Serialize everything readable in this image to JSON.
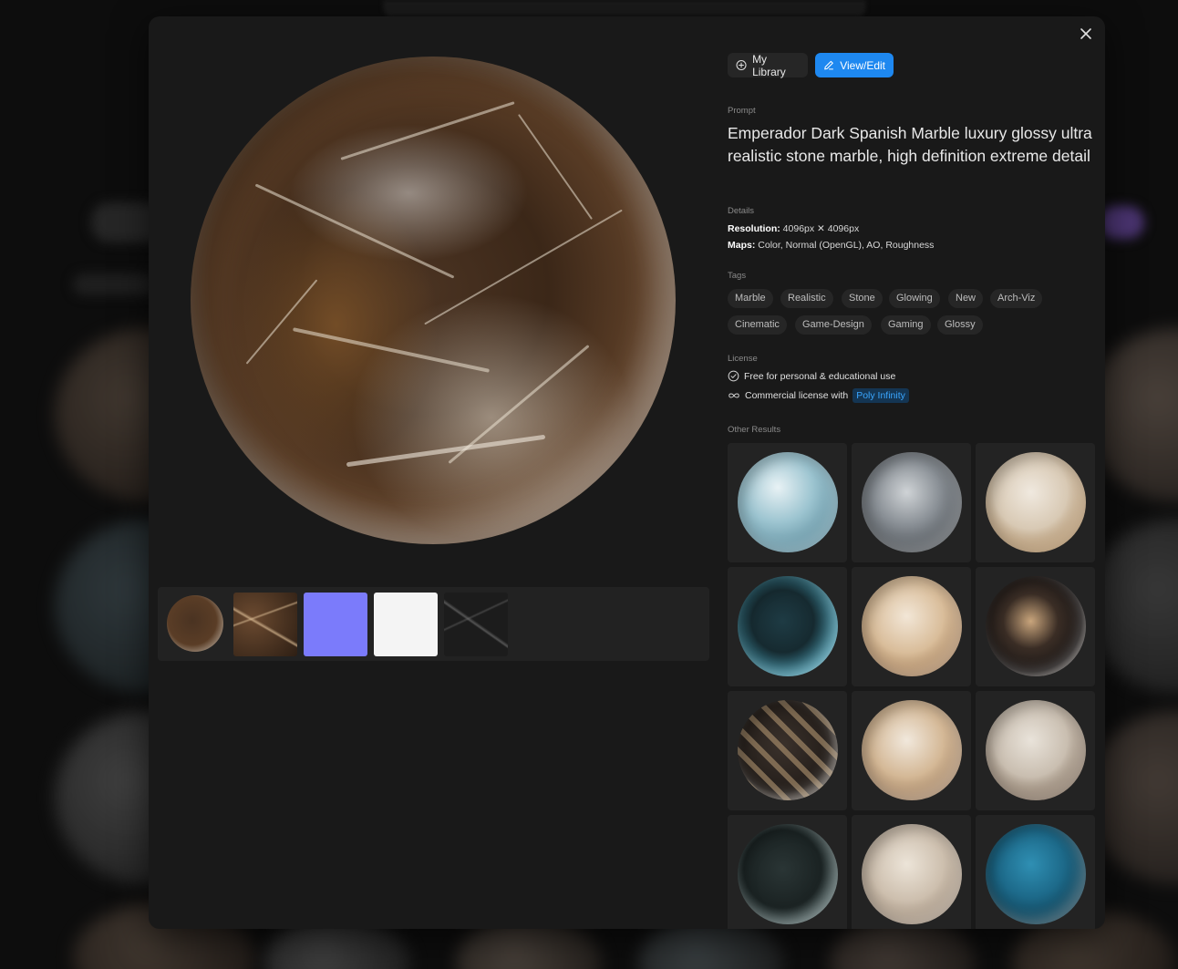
{
  "modal": {
    "close_icon": "close-icon"
  },
  "actions": {
    "my_library_label": "My Library",
    "view_edit_label": "View/Edit",
    "my_library_icon": "plus-circle-icon",
    "view_edit_icon": "edit-icon"
  },
  "prompt": {
    "label": "Prompt",
    "text": "Emperador Dark Spanish Marble luxury glossy ultra realistic stone marble, high definition extreme detail"
  },
  "details": {
    "label": "Details",
    "resolution_key": "Resolution:",
    "resolution_value": "4096px ✕ 4096px",
    "maps_key": "Maps:",
    "maps_value": "Color, Normal (OpenGL), AO, Roughness"
  },
  "tags": {
    "label": "Tags",
    "items": [
      "Marble",
      "Realistic",
      "Stone",
      "Glowing",
      "New",
      "Arch-Viz",
      "Cinematic",
      "Game-Design",
      "Gaming",
      "Glossy"
    ]
  },
  "license": {
    "label": "License",
    "personal": "Free for personal & educational use",
    "commercial": "Commercial license with",
    "commercial_link": "Poly Infinity"
  },
  "other_results": {
    "label": "Other Results"
  },
  "colors": {
    "accent": "#1e88f0",
    "link": "#3aa6ff",
    "modal_bg": "#191919",
    "normal_map": "#7b7bfb"
  }
}
